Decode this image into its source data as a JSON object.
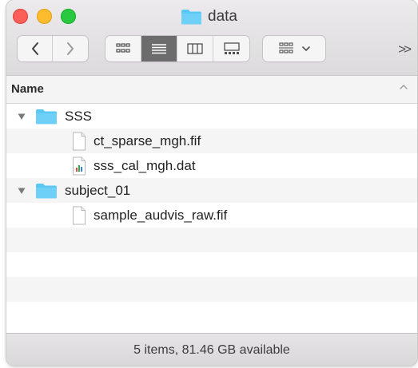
{
  "window": {
    "title": "data"
  },
  "toolbar": {
    "back_icon": "chevron-left-icon",
    "forward_icon": "chevron-right-icon",
    "view_modes": [
      "icon-view-icon",
      "list-view-icon",
      "column-view-icon",
      "gallery-view-icon"
    ],
    "active_view": "list-view-icon",
    "group_icon": "group-by-icon",
    "more_label": ">>"
  },
  "column_header": {
    "name_label": "Name",
    "sort": "ascending"
  },
  "files": [
    {
      "name": "SSS",
      "kind": "folder",
      "expanded": true,
      "depth": 0
    },
    {
      "name": "ct_sparse_mgh.fif",
      "kind": "document",
      "depth": 1
    },
    {
      "name": "sss_cal_mgh.dat",
      "kind": "data-file",
      "depth": 1
    },
    {
      "name": "subject_01",
      "kind": "folder",
      "expanded": true,
      "depth": 0
    },
    {
      "name": "sample_audvis_raw.fif",
      "kind": "document",
      "depth": 1
    }
  ],
  "status": {
    "text": "5 items, 81.46 GB available"
  },
  "colors": {
    "folder": "#5ac8f5",
    "close": "#fc5f57",
    "minimize": "#fdbc2e",
    "maximize": "#28c840",
    "active_segment": "#6c6c6c"
  }
}
